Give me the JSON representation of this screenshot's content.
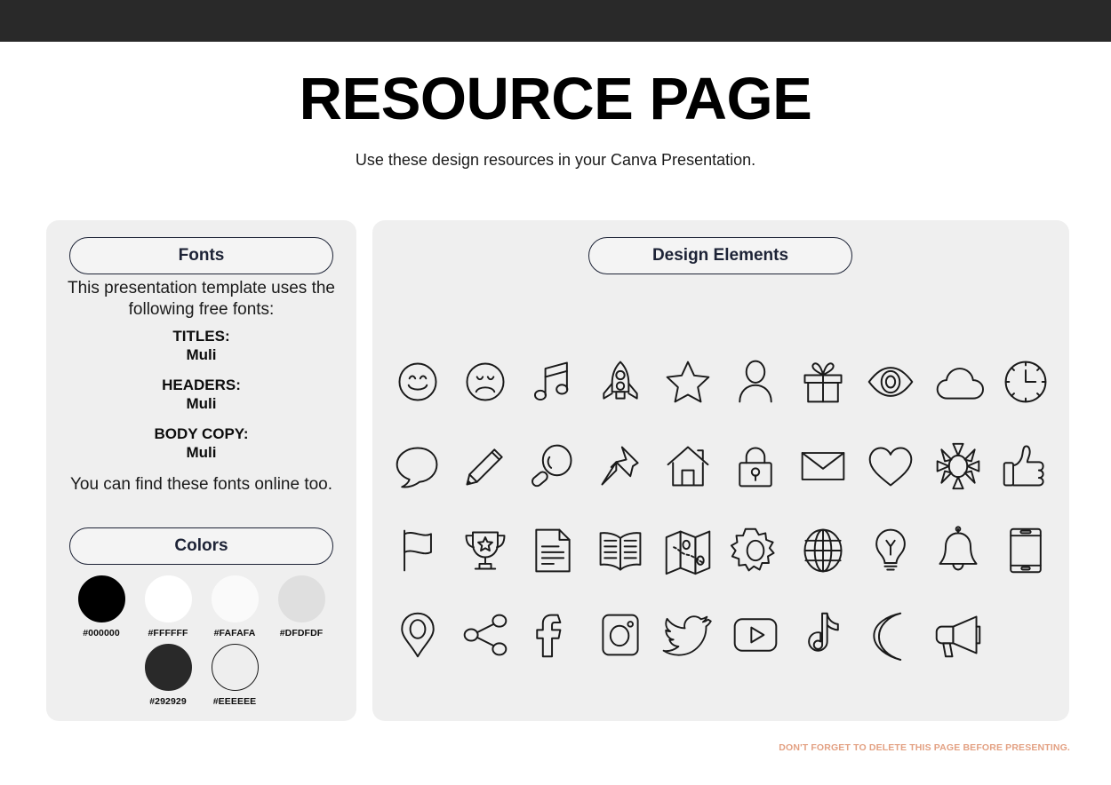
{
  "topbar": {
    "color": "#292929"
  },
  "header": {
    "title": "RESOURCE PAGE",
    "subtitle": "Use these design resources in your Canva Presentation."
  },
  "fonts_panel": {
    "pill_label": "Fonts",
    "intro": "This presentation template uses the following free fonts:",
    "groups": [
      {
        "label": "TITLES:",
        "value": "Muli"
      },
      {
        "label": "HEADERS:",
        "value": "Muli"
      },
      {
        "label": "BODY COPY:",
        "value": "Muli"
      }
    ],
    "outro": "You can find these fonts online too."
  },
  "colors_panel": {
    "pill_label": "Colors",
    "row1": [
      {
        "hex": "#000000",
        "label": "#000000",
        "outlined": false
      },
      {
        "hex": "#FFFFFF",
        "label": "#FFFFFF",
        "outlined": false
      },
      {
        "hex": "#FAFAFA",
        "label": "#FAFAFA",
        "outlined": false
      },
      {
        "hex": "#DFDFDF",
        "label": "#DFDFDF",
        "outlined": false
      }
    ],
    "row2": [
      {
        "hex": "#292929",
        "label": "#292929",
        "outlined": false
      },
      {
        "hex": "#EEEEEE",
        "label": "#EEEEEE",
        "outlined": true
      }
    ]
  },
  "design_panel": {
    "pill_label": "Design Elements",
    "icons": [
      "smiley-face-icon",
      "sad-face-icon",
      "music-note-icon",
      "rocket-icon",
      "star-icon",
      "person-icon",
      "gift-icon",
      "eye-icon",
      "cloud-icon",
      "clock-icon",
      "speech-bubble-icon",
      "pencil-icon",
      "magnifying-glass-icon",
      "pushpin-icon",
      "house-icon",
      "lock-icon",
      "envelope-icon",
      "heart-icon",
      "sun-icon",
      "thumbs-up-icon",
      "flag-icon",
      "trophy-icon",
      "document-icon",
      "open-book-icon",
      "map-icon",
      "gear-icon",
      "globe-icon",
      "lightbulb-icon",
      "bell-icon",
      "phone-icon",
      "location-pin-icon",
      "share-icon",
      "facebook-icon",
      "instagram-icon",
      "twitter-icon",
      "youtube-icon",
      "tiktok-icon",
      "moon-icon",
      "megaphone-icon"
    ]
  },
  "footer": {
    "note": "DON'T FORGET TO DELETE THIS PAGE BEFORE PRESENTING.",
    "note_color": "#E3A183"
  }
}
